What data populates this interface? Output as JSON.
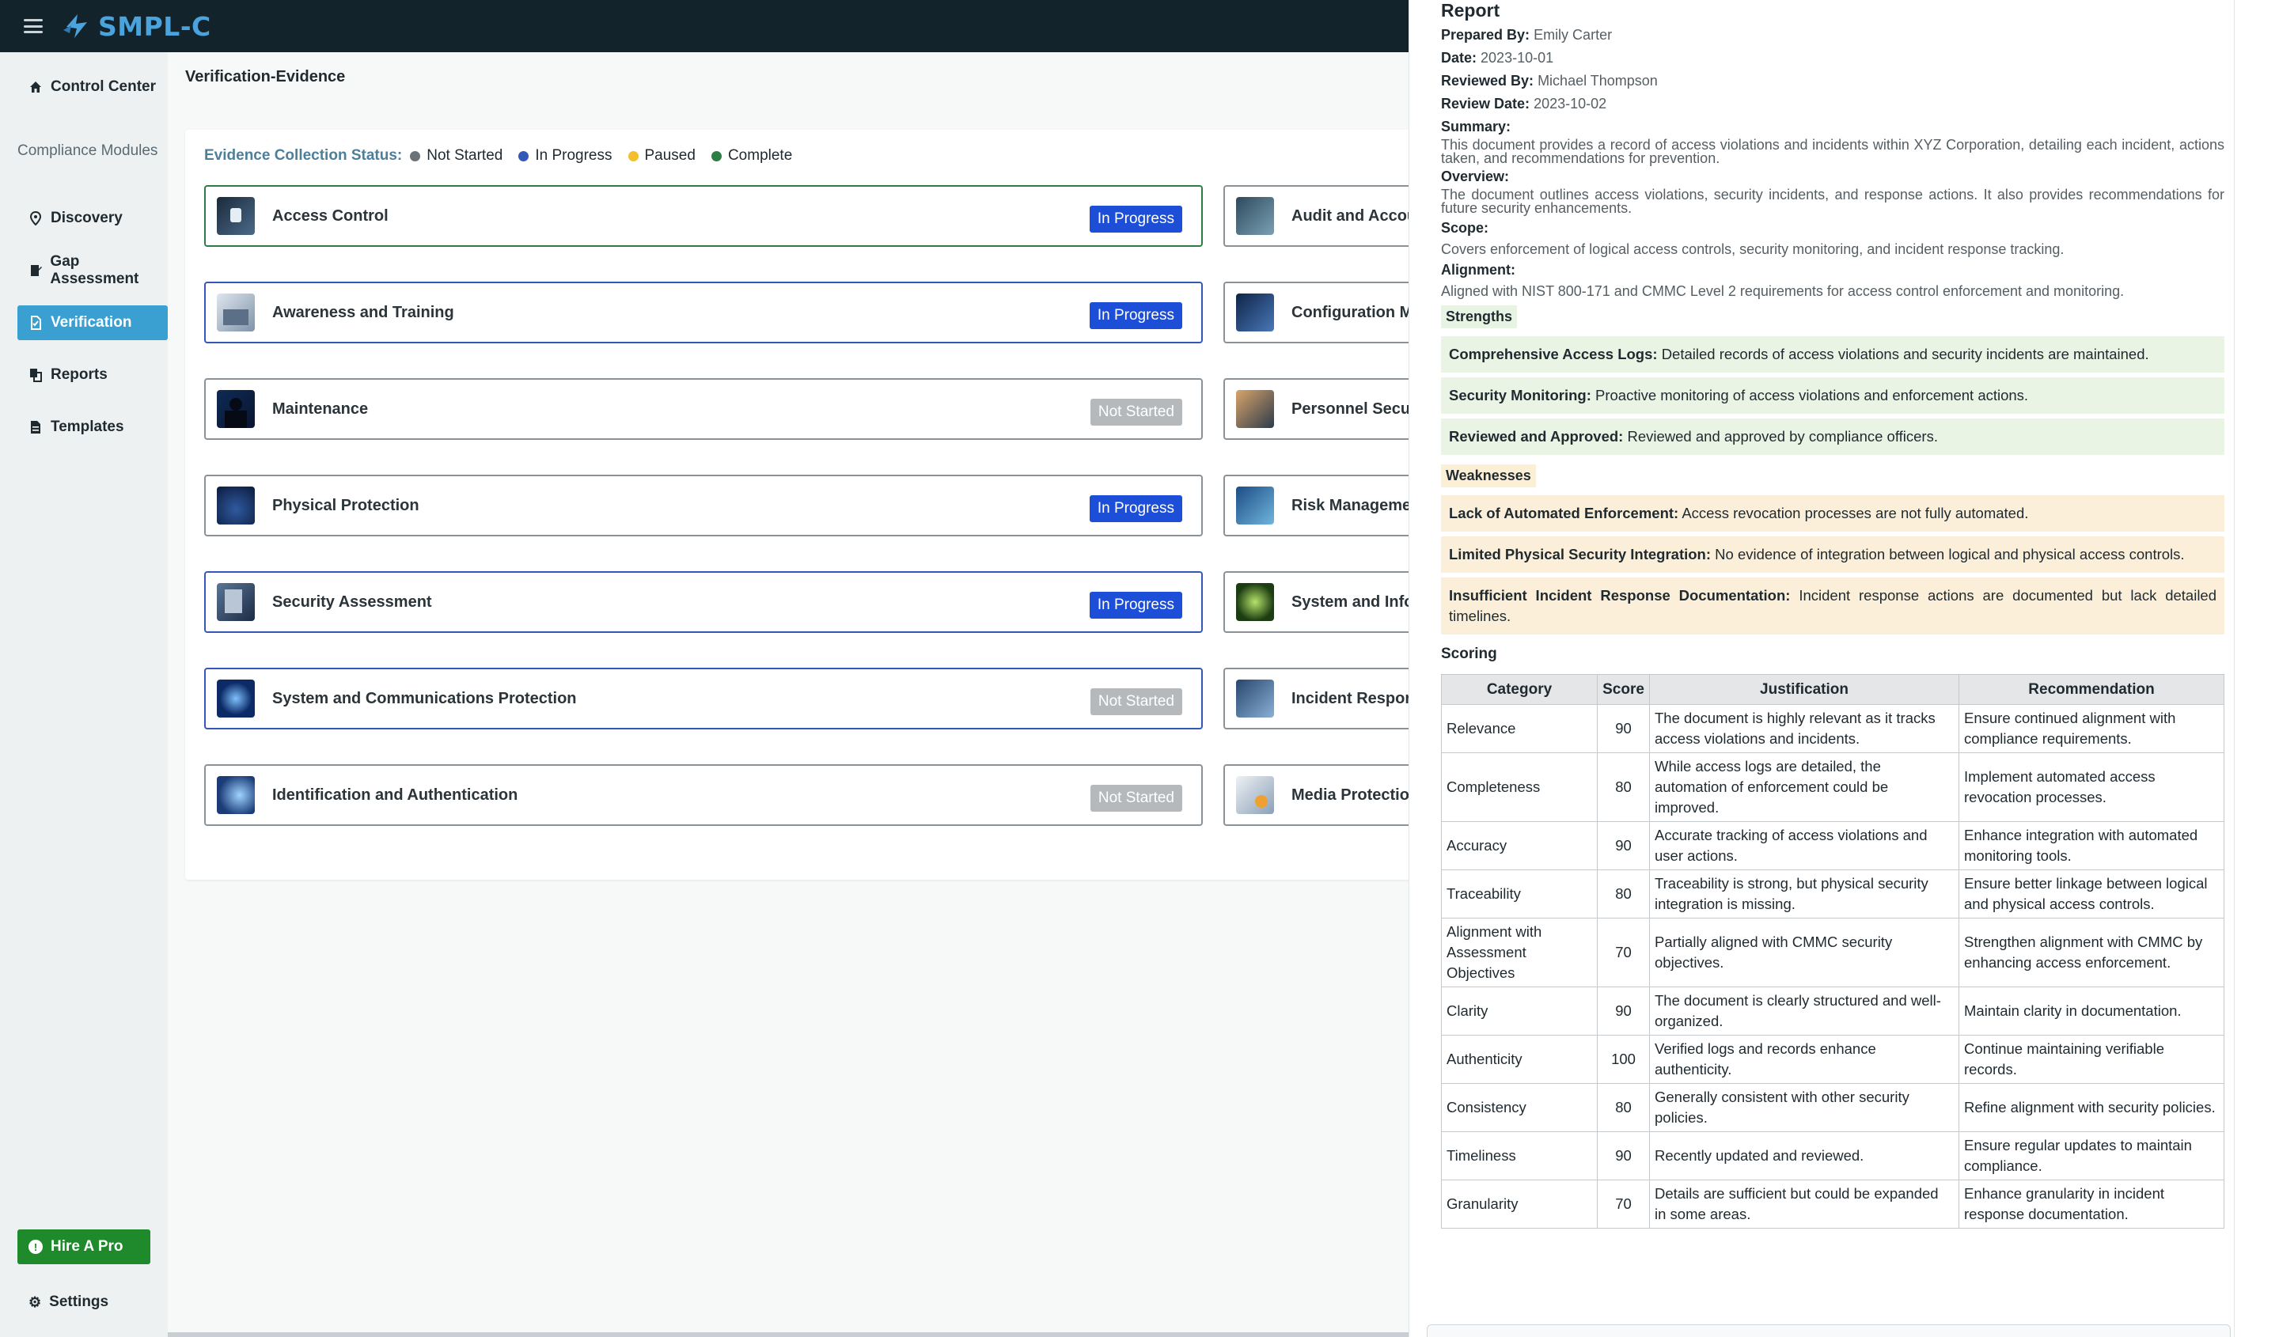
{
  "app": {
    "logo_text": "SMPL-C"
  },
  "sidebar": {
    "control_center": "Control Center",
    "section_label": "Compliance Modules",
    "items": [
      {
        "label": "Discovery"
      },
      {
        "label": "Gap Assessment"
      },
      {
        "label": "Verification"
      },
      {
        "label": "Reports"
      },
      {
        "label": "Templates"
      }
    ],
    "hire_label": "Hire A Pro",
    "settings_label": "Settings"
  },
  "main": {
    "page_title": "Verification-Evidence",
    "status_label": "Evidence Collection Status:",
    "legend": [
      {
        "label": "Not Started",
        "color": "#6b7378"
      },
      {
        "label": "In Progress",
        "color": "#3358b5"
      },
      {
        "label": "Paused",
        "color": "#f3c02b"
      },
      {
        "label": "Complete",
        "color": "#2e7d44"
      }
    ],
    "cards_left": [
      {
        "name": "Access Control",
        "status": "In Progress"
      },
      {
        "name": "Awareness and Training",
        "status": "In Progress"
      },
      {
        "name": "Maintenance",
        "status": "Not Started"
      },
      {
        "name": "Physical Protection",
        "status": "In Progress"
      },
      {
        "name": "Security Assessment",
        "status": "In Progress"
      },
      {
        "name": "System and Communications Protection",
        "status": "Not Started"
      },
      {
        "name": "Identification and Authentication",
        "status": "Not Started"
      }
    ],
    "cards_right": [
      {
        "name": "Audit and Accou"
      },
      {
        "name": "Configuration M"
      },
      {
        "name": "Personnel Secur"
      },
      {
        "name": "Risk Manageme"
      },
      {
        "name": "System and Info"
      },
      {
        "name": "Incident Respor"
      },
      {
        "name": "Media Protectio"
      }
    ]
  },
  "report": {
    "title": "Report",
    "prepared_by_label": "Prepared By:",
    "prepared_by": "Emily Carter",
    "date_label": "Date:",
    "date": "2023-10-01",
    "reviewed_by_label": "Reviewed By:",
    "reviewed_by": "Michael Thompson",
    "review_date_label": "Review Date:",
    "review_date": "2023-10-02",
    "summary_label": "Summary:",
    "summary": "This document provides a record of access violations and incidents within XYZ Corporation, detailing each incident, actions taken, and recommendations for prevention.",
    "overview_label": "Overview:",
    "overview": "The document outlines access violations, security incidents, and response actions. It also provides recommendations for future security enhancements.",
    "scope_label": "Scope:",
    "scope": "Covers enforcement of logical access controls, security monitoring, and incident response tracking.",
    "alignment_label": "Alignment:",
    "alignment": "Aligned with NIST 800-171 and CMMC Level 2 requirements for access control enforcement and monitoring.",
    "strengths_label": "Strengths",
    "strengths": [
      {
        "title": "Comprehensive Access Logs:",
        "text": "Detailed records of access violations and security incidents are maintained."
      },
      {
        "title": "Security Monitoring:",
        "text": "Proactive monitoring of access violations and enforcement actions."
      },
      {
        "title": "Reviewed and Approved:",
        "text": "Reviewed and approved by compliance officers."
      }
    ],
    "weaknesses_label": "Weaknesses",
    "weaknesses": [
      {
        "title": "Lack of Automated Enforcement:",
        "text": "Access revocation processes are not fully automated."
      },
      {
        "title": "Limited Physical Security Integration:",
        "text": "No evidence of integration between logical and physical access controls."
      },
      {
        "title": "Insufficient Incident Response Documentation:",
        "text": "Incident response actions are documented but lack detailed timelines."
      }
    ],
    "scoring_label": "Scoring",
    "table_headers": [
      "Category",
      "Score",
      "Justification",
      "Recommendation"
    ],
    "table_rows": [
      {
        "category": "Relevance",
        "score": "90",
        "justification": "The document is highly relevant as it tracks access violations and incidents.",
        "recommendation": "Ensure continued alignment with compliance requirements."
      },
      {
        "category": "Completeness",
        "score": "80",
        "justification": "While access logs are detailed, the automation of enforcement could be improved.",
        "recommendation": "Implement automated access revocation processes."
      },
      {
        "category": "Accuracy",
        "score": "90",
        "justification": "Accurate tracking of access violations and user actions.",
        "recommendation": "Enhance integration with automated monitoring tools."
      },
      {
        "category": "Traceability",
        "score": "80",
        "justification": "Traceability is strong, but physical security integration is missing.",
        "recommendation": "Ensure better linkage between logical and physical access controls."
      },
      {
        "category": "Alignment with Assessment Objectives",
        "score": "70",
        "justification": "Partially aligned with CMMC security objectives.",
        "recommendation": "Strengthen alignment with CMMC by enhancing access enforcement."
      },
      {
        "category": "Clarity",
        "score": "90",
        "justification": "The document is clearly structured and well-organized.",
        "recommendation": "Maintain clarity in documentation."
      },
      {
        "category": "Authenticity",
        "score": "100",
        "justification": "Verified logs and records enhance authenticity.",
        "recommendation": "Continue maintaining verifiable records."
      },
      {
        "category": "Consistency",
        "score": "80",
        "justification": "Generally consistent with other security policies.",
        "recommendation": "Refine alignment with security policies."
      },
      {
        "category": "Timeliness",
        "score": "90",
        "justification": "Recently updated and reviewed.",
        "recommendation": "Ensure regular updates to maintain compliance."
      },
      {
        "category": "Granularity",
        "score": "70",
        "justification": "Details are sufficient but could be expanded in some areas.",
        "recommendation": "Enhance granularity in incident response documentation."
      }
    ]
  }
}
